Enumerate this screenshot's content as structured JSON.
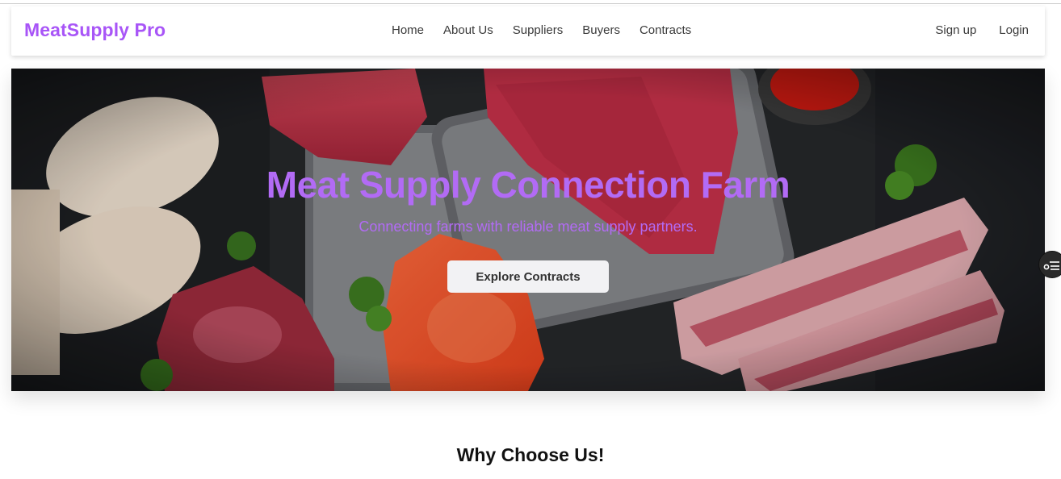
{
  "brand": {
    "name": "MeatSupply Pro",
    "color": "#a855f7"
  },
  "nav": {
    "items": [
      {
        "label": "Home"
      },
      {
        "label": "About Us"
      },
      {
        "label": "Suppliers"
      },
      {
        "label": "Buyers"
      },
      {
        "label": "Contracts"
      }
    ]
  },
  "auth": {
    "signup_label": "Sign up",
    "login_label": "Login"
  },
  "hero": {
    "title": "Meat Supply Connection Farm",
    "subtitle": "Connecting farms with reliable meat supply partners.",
    "cta_label": "Explore Contracts",
    "accent_color": "#b26bf5"
  },
  "features": {
    "title": "Why Choose Us!"
  },
  "side_widget": {
    "icon": "accessibility-menu-icon"
  }
}
